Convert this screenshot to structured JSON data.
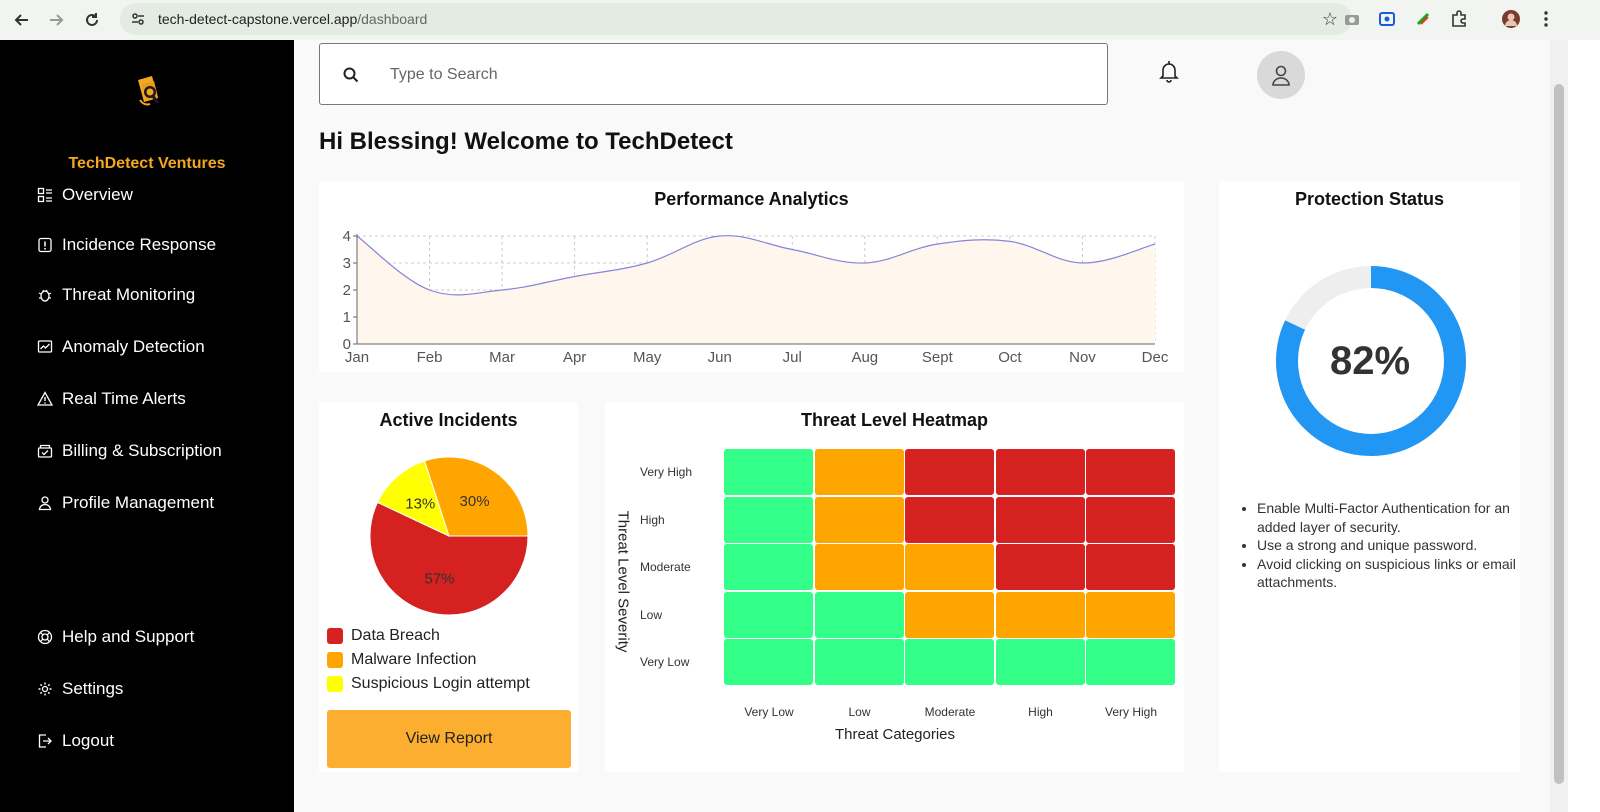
{
  "browser": {
    "url_domain": "tech-detect-capstone.vercel.app",
    "url_path": "/dashboard"
  },
  "sidebar": {
    "brand": "TechDetect Ventures",
    "items": [
      {
        "label": "Overview",
        "icon": "overview-icon"
      },
      {
        "label": "Incidence Response",
        "icon": "alert-square-icon"
      },
      {
        "label": "Threat Monitoring",
        "icon": "bug-icon"
      },
      {
        "label": "Anomaly Detection",
        "icon": "chart-monitor-icon"
      },
      {
        "label": "Real Time Alerts",
        "icon": "warning-triangle-icon"
      },
      {
        "label": "Billing & Subscription",
        "icon": "billing-icon"
      },
      {
        "label": "Profile Management",
        "icon": "user-icon"
      }
    ],
    "bottom_items": [
      {
        "label": "Help and Support",
        "icon": "help-icon"
      },
      {
        "label": "Settings",
        "icon": "gear-icon"
      },
      {
        "label": "Logout",
        "icon": "logout-icon"
      }
    ]
  },
  "header": {
    "search_placeholder": "Type to Search",
    "welcome": "Hi Blessing! Welcome to TechDetect"
  },
  "performance": {
    "title": "Performance Analytics",
    "line_color": "#8884d8",
    "fill_color": "#fff6ee"
  },
  "incidents": {
    "title": "Active Incidents",
    "button_label": "View Report",
    "legend": [
      {
        "label": "Data Breach",
        "color": "#d62121"
      },
      {
        "label": "Malware Infection",
        "color": "#ffa500"
      },
      {
        "label": "Suspicious Login attempt",
        "color": "#ffff00"
      }
    ]
  },
  "heatmap": {
    "title": "Threat Level Heatmap",
    "ylabel": "Threat Level Severity",
    "xlabel": "Threat Categories",
    "rows": [
      "Very High",
      "High",
      "Moderate",
      "Low",
      "Very Low"
    ],
    "cols": [
      "Very Low",
      "Low",
      "Moderate",
      "High",
      "Very High"
    ],
    "colors": {
      "G": "#33ff88",
      "O": "#ffa500",
      "R": "#d62121"
    },
    "grid": [
      [
        "G",
        "O",
        "R",
        "R",
        "R"
      ],
      [
        "G",
        "O",
        "R",
        "R",
        "R"
      ],
      [
        "G",
        "O",
        "O",
        "R",
        "R"
      ],
      [
        "G",
        "G",
        "O",
        "O",
        "O"
      ],
      [
        "G",
        "G",
        "G",
        "G",
        "G"
      ]
    ]
  },
  "protection": {
    "title": "Protection Status",
    "value_label": "82%",
    "percent": 82,
    "ring_color": "#2196f3",
    "track_color": "#eeeeee",
    "tips": [
      "Enable Multi-Factor Authentication for an added layer of security.",
      "Use a strong and unique password.",
      "Avoid clicking on suspicious links or email attachments."
    ]
  },
  "chart_data": [
    {
      "type": "area",
      "title": "Performance Analytics",
      "categories": [
        "Jan",
        "Feb",
        "Mar",
        "Apr",
        "May",
        "Jun",
        "Jul",
        "Aug",
        "Sept",
        "Oct",
        "Nov",
        "Dec"
      ],
      "values": [
        4,
        2,
        2,
        2.5,
        3,
        4,
        3.5,
        3,
        3.7,
        3.8,
        3,
        3.7
      ],
      "ylim": [
        0,
        4
      ],
      "yticks": [
        0,
        1,
        2,
        3,
        4
      ],
      "grid": true
    },
    {
      "type": "pie",
      "title": "Active Incidents",
      "categories": [
        "Data Breach",
        "Malware Infection",
        "Suspicious Login attempt"
      ],
      "values": [
        57,
        30,
        13
      ],
      "labels": [
        "57%",
        "30%",
        "13%"
      ]
    }
  ]
}
